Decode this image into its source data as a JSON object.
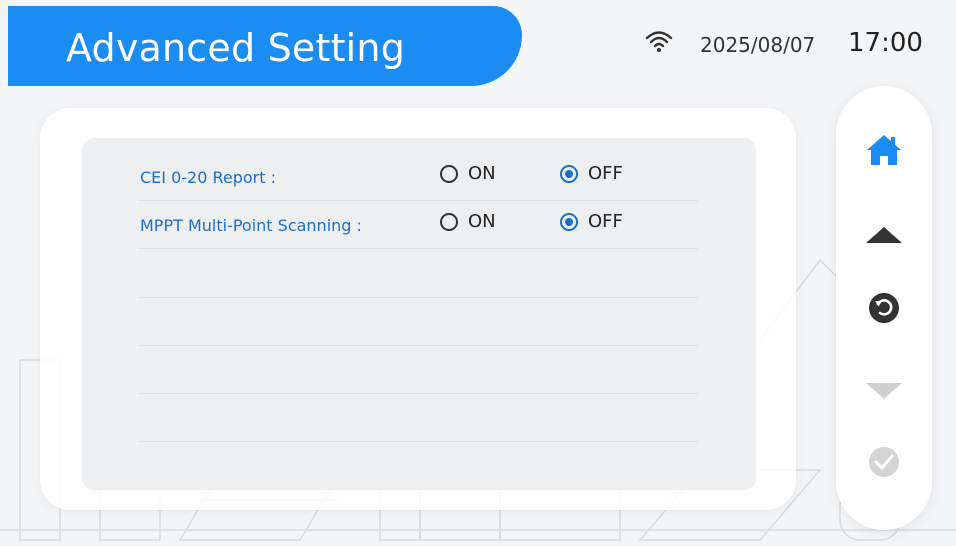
{
  "header": {
    "title": "Advanced Setting",
    "date": "2025/08/07",
    "time": "17:00",
    "wifi_icon": "wifi-icon"
  },
  "settings": [
    {
      "label": "CEI 0-20 Report :",
      "on_label": "ON",
      "off_label": "OFF",
      "selected": "OFF"
    },
    {
      "label": "MPPT Multi-Point Scanning :",
      "on_label": "ON",
      "off_label": "OFF",
      "selected": "OFF"
    }
  ],
  "sidenav": {
    "items": [
      {
        "icon": "home-icon",
        "enabled": true
      },
      {
        "icon": "arrow-up-icon",
        "enabled": true
      },
      {
        "icon": "back-icon",
        "enabled": true
      },
      {
        "icon": "arrow-down-icon",
        "enabled": false
      },
      {
        "icon": "confirm-icon",
        "enabled": false
      }
    ]
  },
  "colors": {
    "accent": "#1b8df2",
    "label_blue": "#1a6fc9",
    "nav_dark": "#333333",
    "nav_disabled": "#cfcfcf"
  }
}
